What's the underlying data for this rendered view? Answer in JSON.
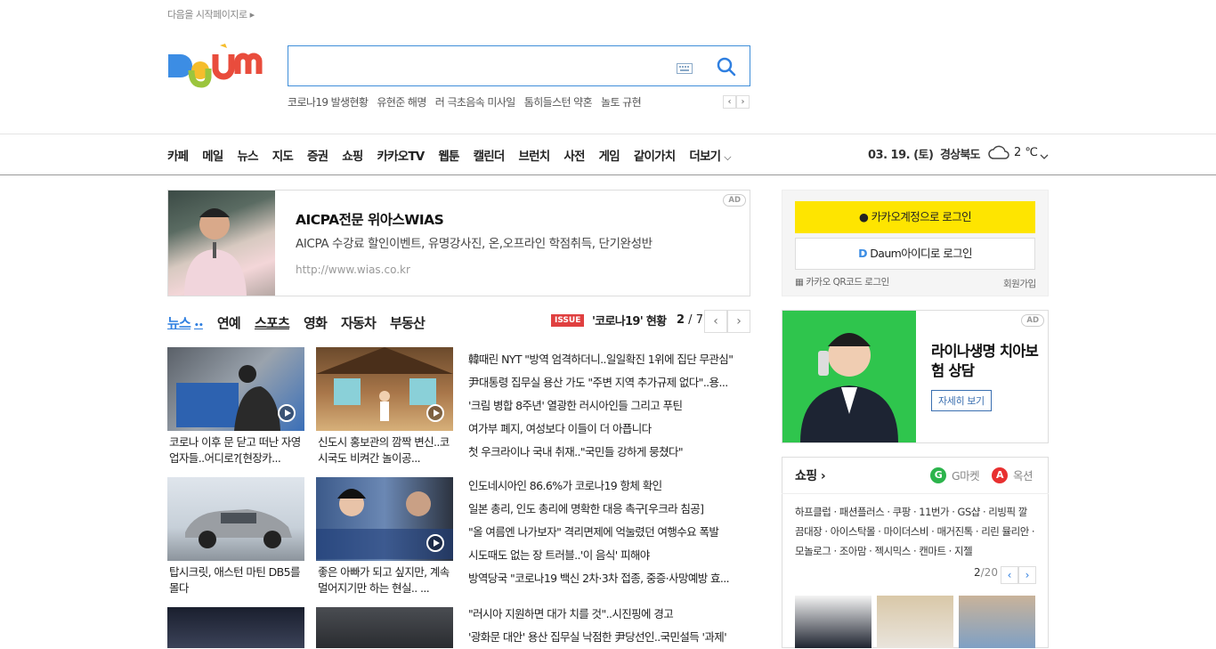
{
  "top": {
    "set_start_page": "다음을 시작페이지로 ▸"
  },
  "brand": {
    "logo_text": "Daum"
  },
  "search": {
    "value": "",
    "placeholder": ""
  },
  "trending": {
    "items": [
      "코로나19 발생현황",
      "유현준 해명",
      "러 극초음속 미사일",
      "톰히들스턴 약혼",
      "놀토 규현"
    ],
    "prev": "‹",
    "next": "›"
  },
  "nav": {
    "items": [
      "카페",
      "메일",
      "뉴스",
      "지도",
      "증권",
      "쇼핑",
      "카카오TV",
      "웹툰",
      "캘린더",
      "브런치",
      "사전",
      "게임",
      "같이가치",
      "더보기"
    ]
  },
  "weather": {
    "date": "03. 19. (토)",
    "region": "경상북도",
    "temp": "2 ℃"
  },
  "ad1": {
    "badge": "AD",
    "title": "AICPA전문 위아스WIAS",
    "desc": "AICPA 수강료 할인이벤트, 유명강사진, 온,오프라인 학점취득, 단기완성반",
    "url": "http://www.wias.co.kr"
  },
  "news_tabs": {
    "items": [
      "뉴스",
      "연예",
      "스포츠",
      "영화",
      "자동차",
      "부동산"
    ],
    "dots": "••"
  },
  "issue": {
    "badge": "ISSUE",
    "title": "'코로나19' 현황",
    "page_current": "2",
    "page_total": " / 7",
    "prev": "‹",
    "next": "›"
  },
  "thumbs": [
    {
      "caption": "코로나 이후 문 닫고 떠난 자영업자들..어디로?[현장카..."
    },
    {
      "caption": "신도시 홍보관의 깜짝 변신..코시국도 비켜간 놀이공..."
    },
    {
      "caption": "탑시크릿, 애스턴 마틴 DB5를 몰다"
    },
    {
      "caption": "좋은 아빠가 되고 싶지만, 계속 멀어지기만 하는 현실.. ..."
    }
  ],
  "headlines_a": [
    "韓때린 NYT \"방역 엄격하더니..일일확진 1위에 집단 무관심\"",
    "尹대통령 집무실 용산 가도 \"주변 지역 추가규제 없다\"..용...",
    "'크림 병합 8주년' 열광한 러시아인들 그리고 푸틴",
    "여가부 폐지, 여성보다 이들이 더 아픕니다",
    "첫 우크라이나 국내 취재..\"국민들 강하게 뭉쳤다\""
  ],
  "headlines_b": [
    "인도네시아인 86.6%가 코로나19 항체 확인",
    "일본 총리, 인도 총리에 명확한 대응 촉구[우크라 침공]",
    "\"올 여름엔 나가보자\" 격리면제에 억눌렸던 여행수요 폭발",
    "시도때도 없는 장 트러블..'이 음식' 피해야",
    "방역당국 \"코로나19 백신 2차·3차 접종, 중증·사망예방 효..."
  ],
  "headlines_c": [
    "\"러시아 지원하면 대가 치를 것\"..시진핑에 경고",
    "'광화문 대안' 용산 집무실 낙점한 尹당선인..국민설득 '과제'"
  ],
  "login": {
    "kakao": "카카오계정으로 로그인",
    "daum": "Daum아이디로 로그인",
    "qr": "카카오 QR코드 로그인",
    "signup": "회원가입"
  },
  "ad2": {
    "badge": "AD",
    "title": "라이나생명 치아보험 상담",
    "button": "자세히 보기"
  },
  "shopping": {
    "title": "쇼핑 ›",
    "gmarket": "G마켓",
    "auction": "옥션",
    "links": "하프클럽 · 패션플러스 · 쿠팡 · 11번가 · GS샵 · 리빙픽 깔끔대장 · 아이스탁몰 · 마이더스비 · 매거진톡 · 리린 뮬리안 · 모놀로그 · 조아맘 · 젝시믹스 · 캔마트 · 지젤",
    "page_current": "2",
    "page_total": "/20",
    "prev": "‹",
    "next": "›"
  },
  "colors": {
    "accent": "#2f7fe0",
    "kakao": "#fee500",
    "issue": "#e04040",
    "search_border": "#3f8ed9"
  }
}
